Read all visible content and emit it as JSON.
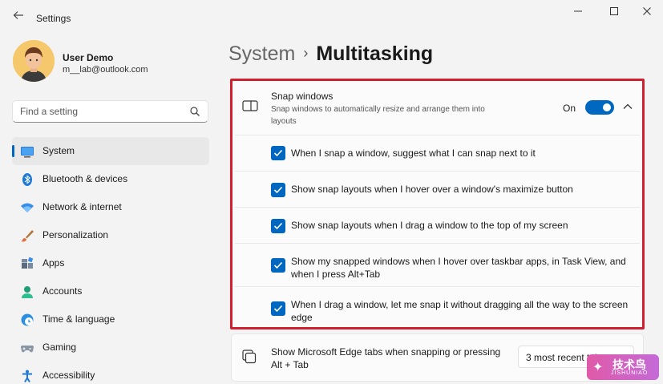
{
  "window": {
    "title": "Settings",
    "back_icon": "arrow-left-icon",
    "controls": [
      "minimize-icon",
      "maximize-icon",
      "close-icon"
    ]
  },
  "user": {
    "name": "User Demo",
    "email": "m__lab@outlook.com"
  },
  "search": {
    "placeholder": "Find a setting"
  },
  "sidebar": {
    "items": [
      {
        "label": "System",
        "icon": "monitor-icon",
        "active": true
      },
      {
        "label": "Bluetooth & devices",
        "icon": "bluetooth-icon"
      },
      {
        "label": "Network & internet",
        "icon": "wifi-icon"
      },
      {
        "label": "Personalization",
        "icon": "brush-icon"
      },
      {
        "label": "Apps",
        "icon": "apps-icon"
      },
      {
        "label": "Accounts",
        "icon": "person-icon"
      },
      {
        "label": "Time & language",
        "icon": "globe-clock-icon"
      },
      {
        "label": "Gaming",
        "icon": "gamepad-icon"
      },
      {
        "label": "Accessibility",
        "icon": "accessibility-icon"
      }
    ]
  },
  "breadcrumb": {
    "parent": "System",
    "separator": "›",
    "current": "Multitasking"
  },
  "snap": {
    "title": "Snap windows",
    "description": "Snap windows to automatically resize and arrange them into layouts",
    "toggle_label": "On",
    "toggle_on": true,
    "options": [
      {
        "label": "When I snap a window, suggest what I can snap next to it",
        "checked": true
      },
      {
        "label": "Show snap layouts when I hover over a window's maximize button",
        "checked": true
      },
      {
        "label": "Show snap layouts when I drag a window to the top of my screen",
        "checked": true
      },
      {
        "label": "Show my snapped windows when I hover over taskbar apps, in Task View, and when I press Alt+Tab",
        "checked": true
      },
      {
        "label": "When I drag a window, let me snap it without dragging all the way to the screen edge",
        "checked": true
      }
    ]
  },
  "edge_tabs": {
    "label": "Show Microsoft Edge tabs when snapping or pressing Alt + Tab",
    "value": "3 most recent tabs"
  },
  "watermark": {
    "text": "技术鸟",
    "subtext": "JISHUNIAO"
  },
  "colors": {
    "accent": "#0067c0",
    "highlight_border": "#d02030"
  }
}
